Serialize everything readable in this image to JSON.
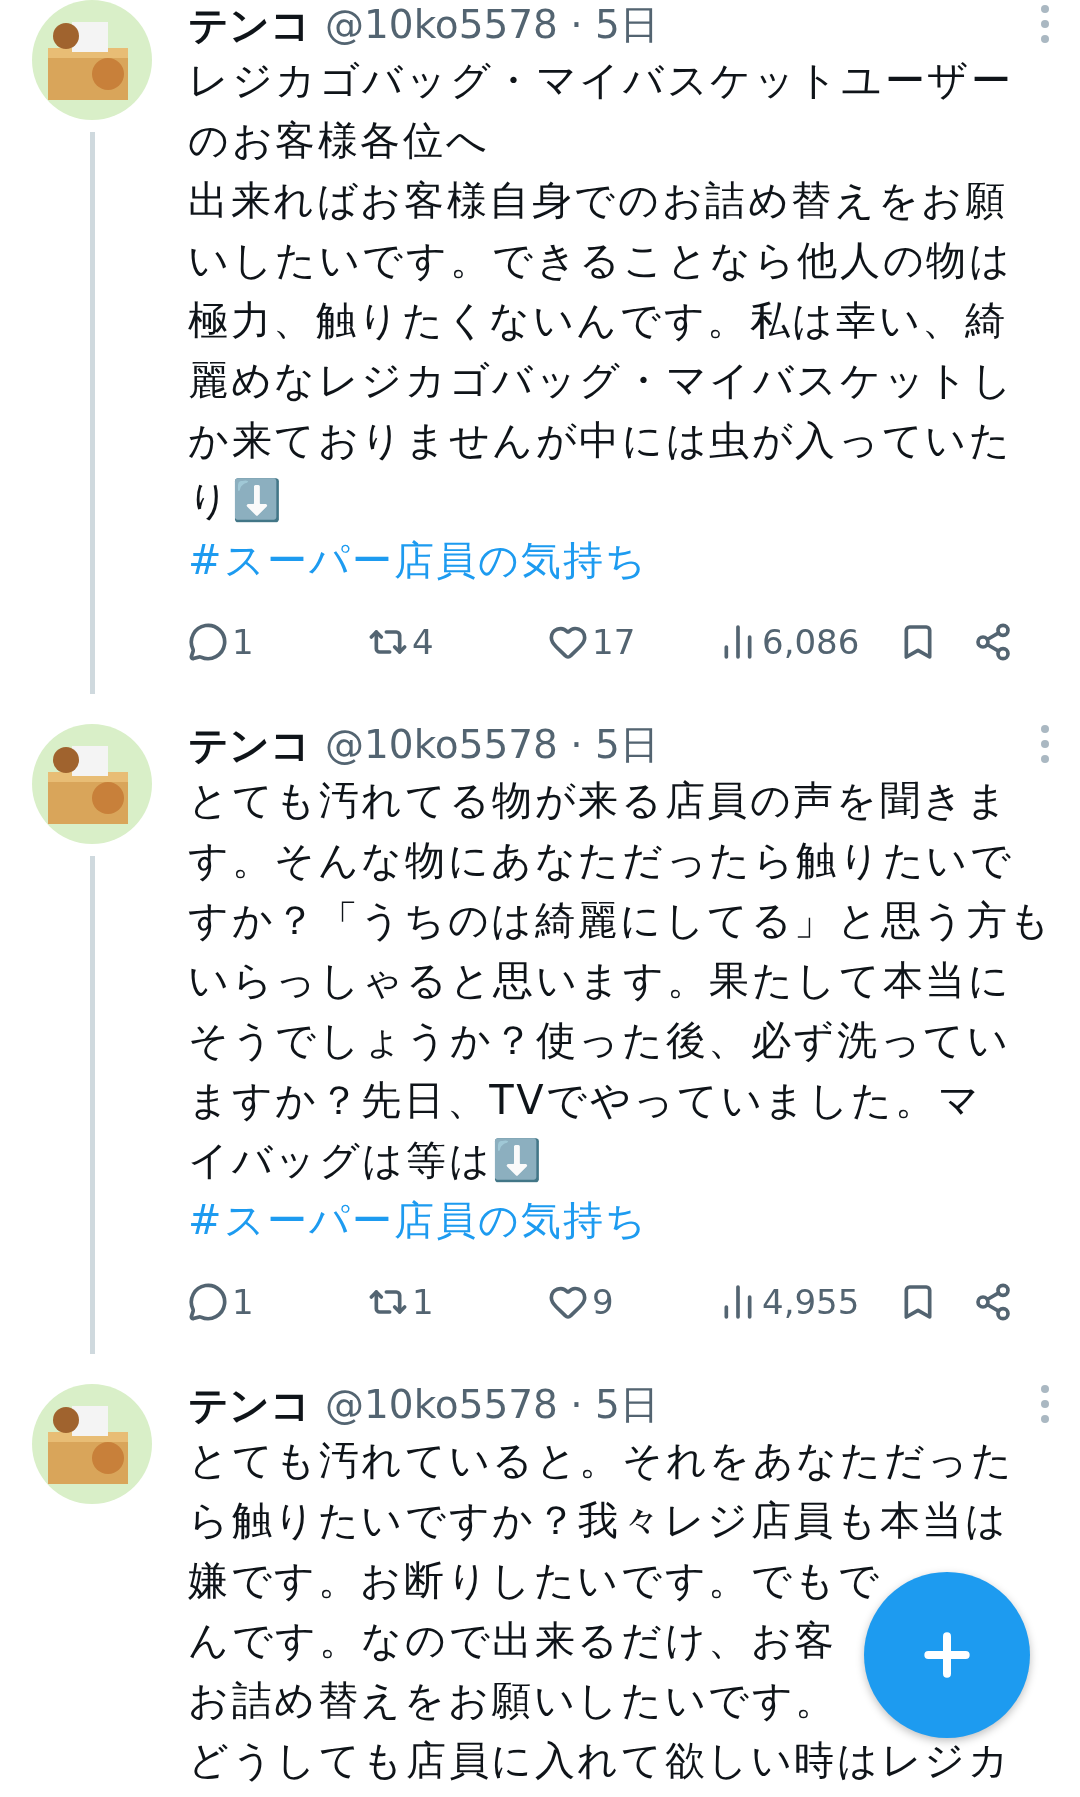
{
  "tweets": [
    {
      "name": "テンコ",
      "meta": "@10ko5578 · 5日",
      "thread_continues": true,
      "lines": [
        "レジカゴバッグ・マイバスケットユーザー",
        "のお客様各位へ",
        "出来ればお客様自身でのお詰め替えをお願",
        "いしたいです。できることなら他人の物は",
        "極力、触りたくないんです。私は幸い、綺",
        "麗めなレジカゴバッグ・マイバスケットし",
        "か来ておりませんが中には虫が入っていた",
        "り⬇️"
      ],
      "hashtag": "#スーパー店員の気持ち",
      "actions": [
        {
          "kind": "reply",
          "count": "1"
        },
        {
          "kind": "retweet",
          "count": "4"
        },
        {
          "kind": "like",
          "count": "17"
        },
        {
          "kind": "views",
          "count": "6,086"
        },
        {
          "kind": "bookmark"
        },
        {
          "kind": "share"
        }
      ]
    },
    {
      "name": "テンコ",
      "meta": "@10ko5578 · 5日",
      "thread_continues": true,
      "lines": [
        "とても汚れてる物が来る店員の声を聞きま",
        "す。そんな物にあなただったら触りたいで",
        "すか？「うちのは綺麗にしてる」と思う方も",
        "いらっしゃると思います。果たして本当に",
        "そうでしょうか？使った後、必ず洗ってい",
        "ますか？先日、TVでやっていました。マ",
        "イバッグは等は⬇️"
      ],
      "hashtag": "#スーパー店員の気持ち",
      "actions": [
        {
          "kind": "reply",
          "count": "1"
        },
        {
          "kind": "retweet",
          "count": "1"
        },
        {
          "kind": "like",
          "count": "9"
        },
        {
          "kind": "views",
          "count": "4,955"
        },
        {
          "kind": "bookmark"
        },
        {
          "kind": "share"
        }
      ]
    },
    {
      "name": "テンコ",
      "meta": "@10ko5578 · 5日",
      "thread_continues": false,
      "lines": [
        "とても汚れていると。それをあなただった",
        "ら触りたいですか？我々レジ店員も本当は",
        "嫌です。お断りしたいです。でもで",
        "んです。なので出来るだけ、お客",
        "お詰め替えをお願いしたいです。",
        "どうしても店員に入れて欲しい時はレジカ"
      ]
    }
  ],
  "compose_button": {
    "kind": "plus"
  }
}
